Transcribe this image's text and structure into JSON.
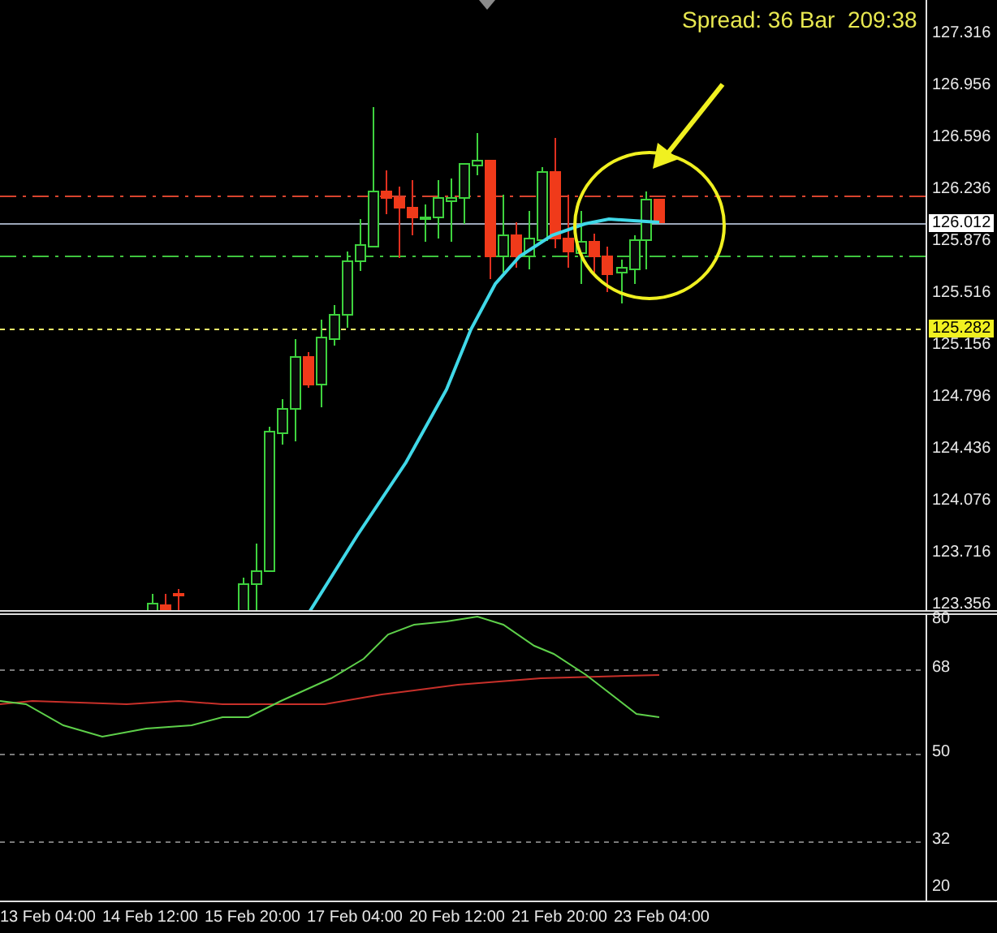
{
  "header": {
    "spread_text": "Spread: 36 Bar  209:38"
  },
  "price_axis": {
    "labels": [
      "127.316",
      "126.956",
      "126.596",
      "126.236",
      "125.876",
      "125.516",
      "125.156",
      "124.796",
      "124.436",
      "124.076",
      "123.716",
      "123.356"
    ],
    "bid_price": "126.012",
    "line_price": "125.282"
  },
  "indicator_axis": {
    "labels": [
      "80",
      "68",
      "50",
      "32",
      "20"
    ]
  },
  "time_axis": {
    "labels": [
      "13 Feb 04:00",
      "14 Feb 12:00",
      "15 Feb 20:00",
      "17 Feb 04:00",
      "20 Feb 12:00",
      "21 Feb 20:00",
      "23 Feb 04:00"
    ]
  }
}
